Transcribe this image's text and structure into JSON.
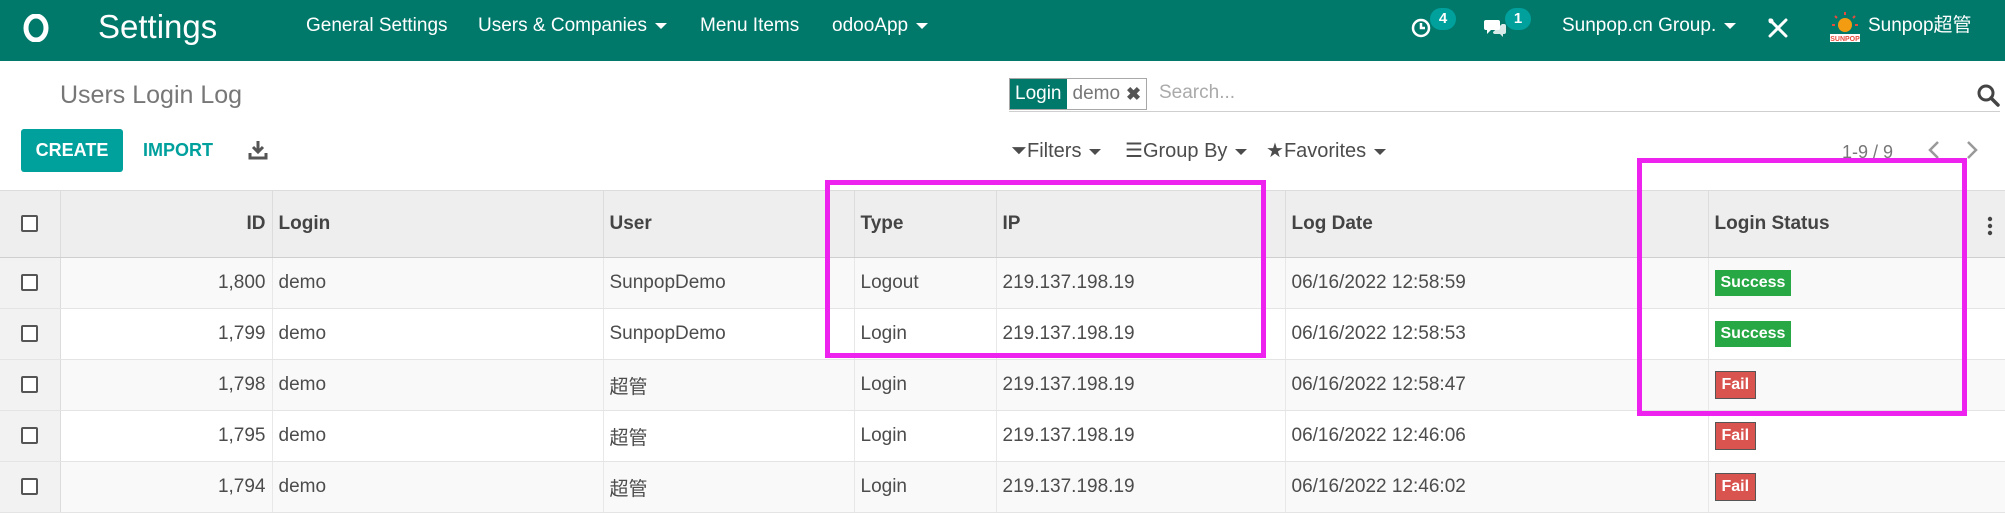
{
  "navbar": {
    "app_title": "Settings",
    "menu": [
      {
        "label": "General Settings",
        "dropdown": false
      },
      {
        "label": "Users & Companies",
        "dropdown": true
      },
      {
        "label": "Menu Items",
        "dropdown": false
      },
      {
        "label": "odooApp",
        "dropdown": true
      }
    ],
    "activity_count": "4",
    "message_count": "1",
    "company": "Sunpop.cn Group.",
    "debug_icon": "bug-tools-icon",
    "user_name": "Sunpop超管",
    "colors": {
      "primary": "#00796b",
      "accent": "#00a09d"
    }
  },
  "control_panel": {
    "breadcrumb": "Users Login Log",
    "search": {
      "facet_label": "Login",
      "facet_value": "demo",
      "placeholder": "Search..."
    },
    "create_label": "CREATE",
    "import_label": "IMPORT",
    "filters_label": "Filters",
    "group_by_label": "Group By",
    "favorites_label": "Favorites",
    "pager": "1-9 / 9"
  },
  "table": {
    "columns": [
      "ID",
      "Login",
      "User",
      "Type",
      "IP",
      "Log Date",
      "Login Status"
    ],
    "rows": [
      {
        "id": "1,800",
        "login": "demo",
        "user": "SunpopDemo",
        "type": "Logout",
        "ip": "219.137.198.19",
        "log_date": "06/16/2022 12:58:59",
        "status": "Success"
      },
      {
        "id": "1,799",
        "login": "demo",
        "user": "SunpopDemo",
        "type": "Login",
        "ip": "219.137.198.19",
        "log_date": "06/16/2022 12:58:53",
        "status": "Success"
      },
      {
        "id": "1,798",
        "login": "demo",
        "user": "超管",
        "type": "Login",
        "ip": "219.137.198.19",
        "log_date": "06/16/2022 12:58:47",
        "status": "Fail"
      },
      {
        "id": "1,795",
        "login": "demo",
        "user": "超管",
        "type": "Login",
        "ip": "219.137.198.19",
        "log_date": "06/16/2022 12:46:06",
        "status": "Fail"
      },
      {
        "id": "1,794",
        "login": "demo",
        "user": "超管",
        "type": "Login",
        "ip": "219.137.198.19",
        "log_date": "06/16/2022 12:46:02",
        "status": "Fail"
      }
    ],
    "status_colors": {
      "Success": "#28a745",
      "Fail": "#d9534f"
    }
  },
  "highlight_color": "#ee22ee"
}
